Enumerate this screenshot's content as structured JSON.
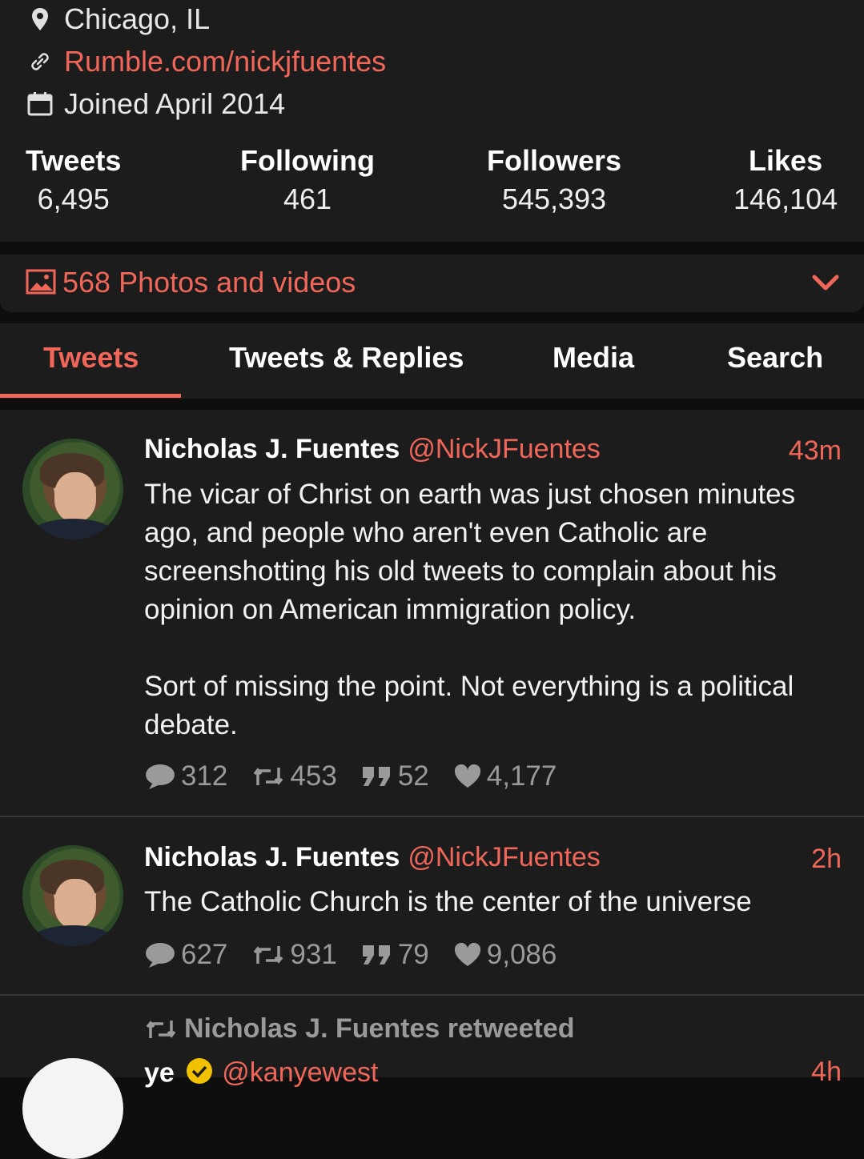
{
  "profile": {
    "location": "Chicago, IL",
    "website": "Rumble.com/nickjfuentes",
    "joined": "Joined April 2014",
    "icons": {
      "location": "location-pin-icon",
      "website": "link-icon",
      "joined": "calendar-icon"
    }
  },
  "stats": [
    {
      "label": "Tweets",
      "value": "6,495"
    },
    {
      "label": "Following",
      "value": "461"
    },
    {
      "label": "Followers",
      "value": "545,393"
    },
    {
      "label": "Likes",
      "value": "146,104"
    }
  ],
  "media": {
    "label": "568 Photos and videos"
  },
  "tabs": [
    {
      "label": "Tweets",
      "active": true
    },
    {
      "label": "Tweets & Replies",
      "active": false
    },
    {
      "label": "Media",
      "active": false
    },
    {
      "label": "Search",
      "active": false
    }
  ],
  "accent_color": "#f0675a",
  "tweets": [
    {
      "name": "Nicholas J. Fuentes",
      "handle": "@NickJFuentes",
      "time": "43m",
      "text_p1": "The vicar of Christ on earth was just chosen minutes ago, and people who aren't even Catholic are screenshotting his old tweets to complain about his opinion on American immigration policy.",
      "text_p2": "Sort of missing the point. Not everything is a political debate.",
      "replies": "312",
      "retweets": "453",
      "quotes": "52",
      "likes": "4,177"
    },
    {
      "name": "Nicholas J. Fuentes",
      "handle": "@NickJFuentes",
      "time": "2h",
      "text_p1": "The Catholic Church is the center of the universe",
      "replies": "627",
      "retweets": "931",
      "quotes": "79",
      "likes": "9,086"
    }
  ],
  "retweet_notice": "Nicholas J. Fuentes retweeted",
  "third_tweet": {
    "name": "ye",
    "handle": "@kanyewest",
    "time": "4h"
  }
}
